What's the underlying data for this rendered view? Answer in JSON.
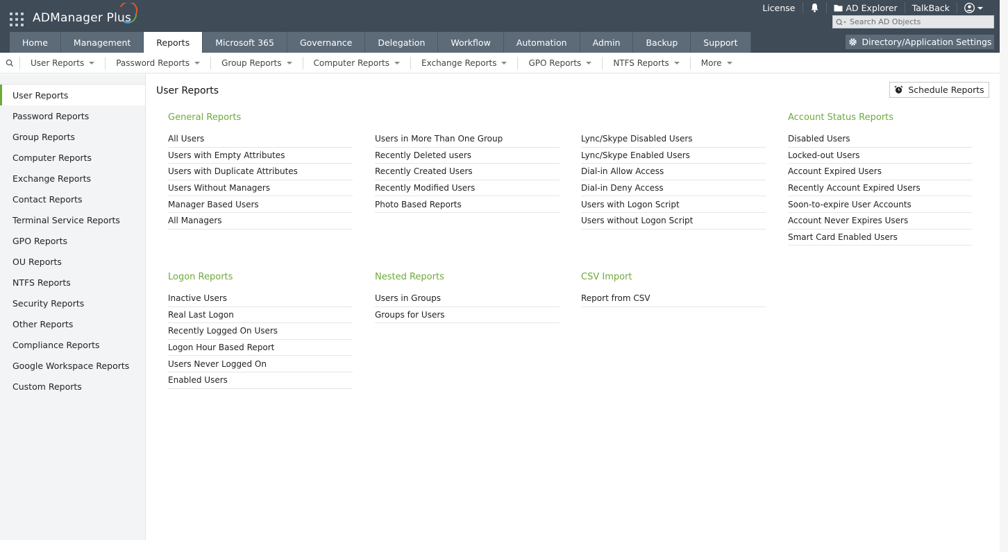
{
  "header": {
    "app_name": "ADManager Plus",
    "top_links": [
      "License",
      "AD Explorer",
      "TalkBack"
    ],
    "search_placeholder": "Search AD Objects",
    "tabs": [
      "Home",
      "Management",
      "Reports",
      "Microsoft 365",
      "Governance",
      "Delegation",
      "Workflow",
      "Automation",
      "Admin",
      "Backup",
      "Support"
    ],
    "active_tab": "Reports",
    "settings_label": "Directory/Application Settings"
  },
  "subnav": {
    "items": [
      "User Reports",
      "Password Reports",
      "Group Reports",
      "Computer Reports",
      "Exchange Reports",
      "GPO Reports",
      "NTFS Reports",
      "More"
    ]
  },
  "sidebar": {
    "items": [
      "User Reports",
      "Password Reports",
      "Group Reports",
      "Computer Reports",
      "Exchange Reports",
      "Contact Reports",
      "Terminal Service Reports",
      "GPO Reports",
      "OU Reports",
      "NTFS Reports",
      "Security Reports",
      "Other Reports",
      "Compliance Reports",
      "Google Workspace Reports",
      "Custom Reports"
    ],
    "active": "User Reports"
  },
  "main": {
    "title": "User Reports",
    "schedule_label": "Schedule Reports",
    "sections": {
      "general": {
        "title": "General Reports",
        "col1": [
          "All Users",
          "Users with Empty Attributes",
          "Users with Duplicate Attributes",
          "Users Without Managers",
          "Manager Based Users",
          "All Managers"
        ],
        "col2": [
          "Users in More Than One Group",
          "Recently Deleted users",
          "Recently Created Users",
          "Recently Modified Users",
          "Photo Based Reports"
        ],
        "col3": [
          "Lync/Skype Disabled Users",
          "Lync/Skype Enabled Users",
          "Dial-in Allow Access",
          "Dial-in Deny Access",
          "Users with Logon Script",
          "Users without Logon Script"
        ]
      },
      "account_status": {
        "title": "Account Status Reports",
        "items": [
          "Disabled Users",
          "Locked-out Users",
          "Account Expired Users",
          "Recently Account Expired Users",
          "Soon-to-expire User Accounts",
          "Account Never Expires Users",
          "Smart Card Enabled Users"
        ]
      },
      "logon": {
        "title": "Logon Reports",
        "items": [
          "Inactive Users",
          "Real Last Logon",
          "Recently Logged On Users",
          "Logon Hour Based Report",
          "Users Never Logged On",
          "Enabled Users"
        ]
      },
      "nested": {
        "title": "Nested Reports",
        "items": [
          "Users in Groups",
          "Groups for Users"
        ]
      },
      "csv": {
        "title": "CSV Import",
        "items": [
          "Report from CSV"
        ]
      }
    }
  },
  "colors": {
    "header_bg": "#3f4b57",
    "tab_bg": "#5d6b79",
    "accent_green": "#6cab3a"
  },
  "icons": [
    "app-grid-icon",
    "bell-icon",
    "folder-icon",
    "user-circle-icon",
    "search-icon",
    "gear-icon",
    "alarm-clock-icon",
    "quick-search-icon"
  ]
}
